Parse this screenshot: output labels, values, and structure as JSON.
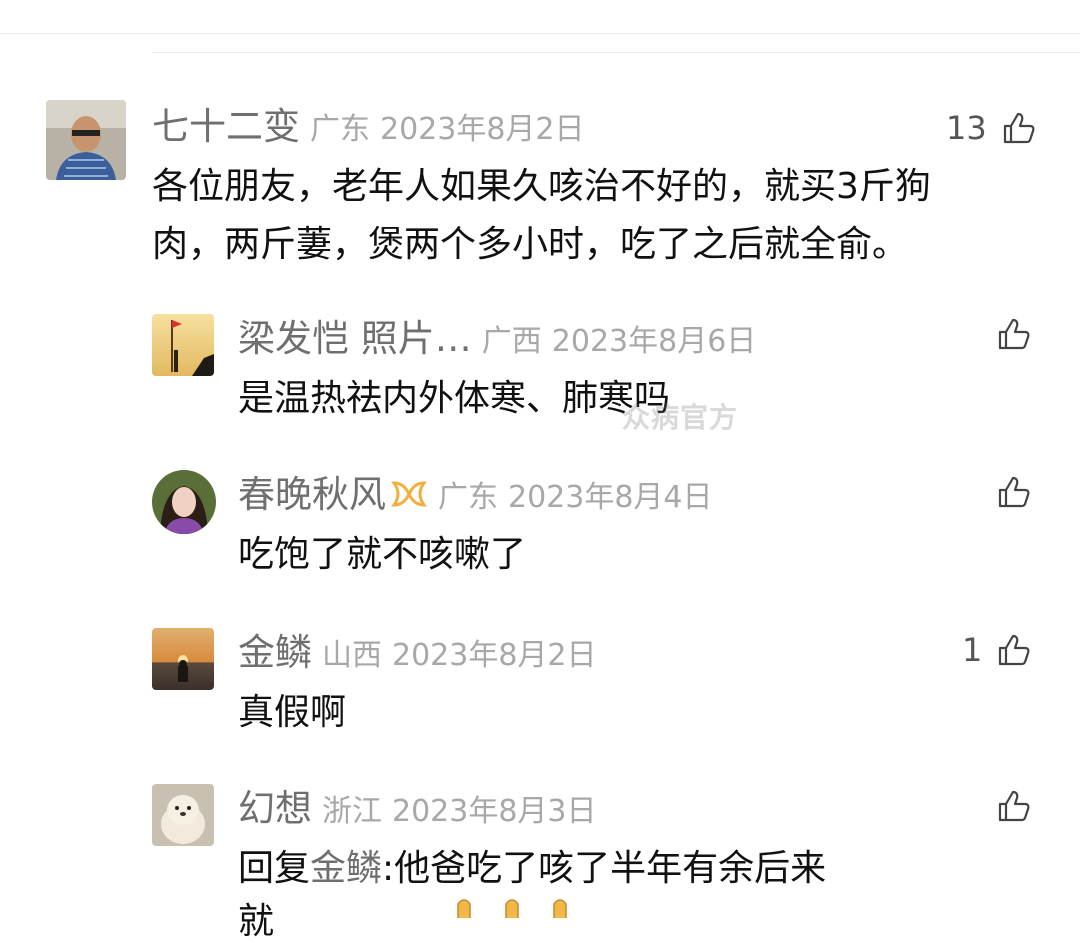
{
  "comments": [
    {
      "name": "七十二变",
      "region": "广东",
      "date": "2023年8月2日",
      "likes": "13",
      "text_lines": [
        "各位朋友，老年人如果久咳治不好的，就买3斤狗",
        "肉，两斤萋，煲两个多小时，吃了之后就全俞。"
      ],
      "avatar": "elderly-man-photo"
    },
    {
      "name": "梁发恺 照片…",
      "region": "广西",
      "date": "2023年8月6日",
      "likes": "",
      "text": "是温热祛内外体寒、肺寒吗",
      "avatar": "sunset-flag-photo"
    },
    {
      "name": "春晚秋风",
      "region": "广东",
      "date": "2023年8月4日",
      "likes": "",
      "text": "吃饱了就不咳嗽了",
      "avatar": "woman-portrait",
      "badge": "vip-badge-icon"
    },
    {
      "name": "金鳞",
      "region": "山西",
      "date": "2023年8月2日",
      "likes": "1",
      "text": "真假啊",
      "avatar": "beach-sunset-photo"
    },
    {
      "name": "幻想",
      "region": "浙江",
      "date": "2023年8月3日",
      "likes": "",
      "reply_prefix": "回复",
      "reply_to": "金鳞",
      "reply_text": ":他爸吃了咳了半年有余后来",
      "avatar": "fluffy-dog-photo",
      "next_line_peek": "就"
    }
  ],
  "watermark": "众病官方",
  "colors": {
    "name": "#6f6f6f",
    "meta": "#a8a8a8",
    "text": "#111111",
    "badge": "#f0b040"
  }
}
